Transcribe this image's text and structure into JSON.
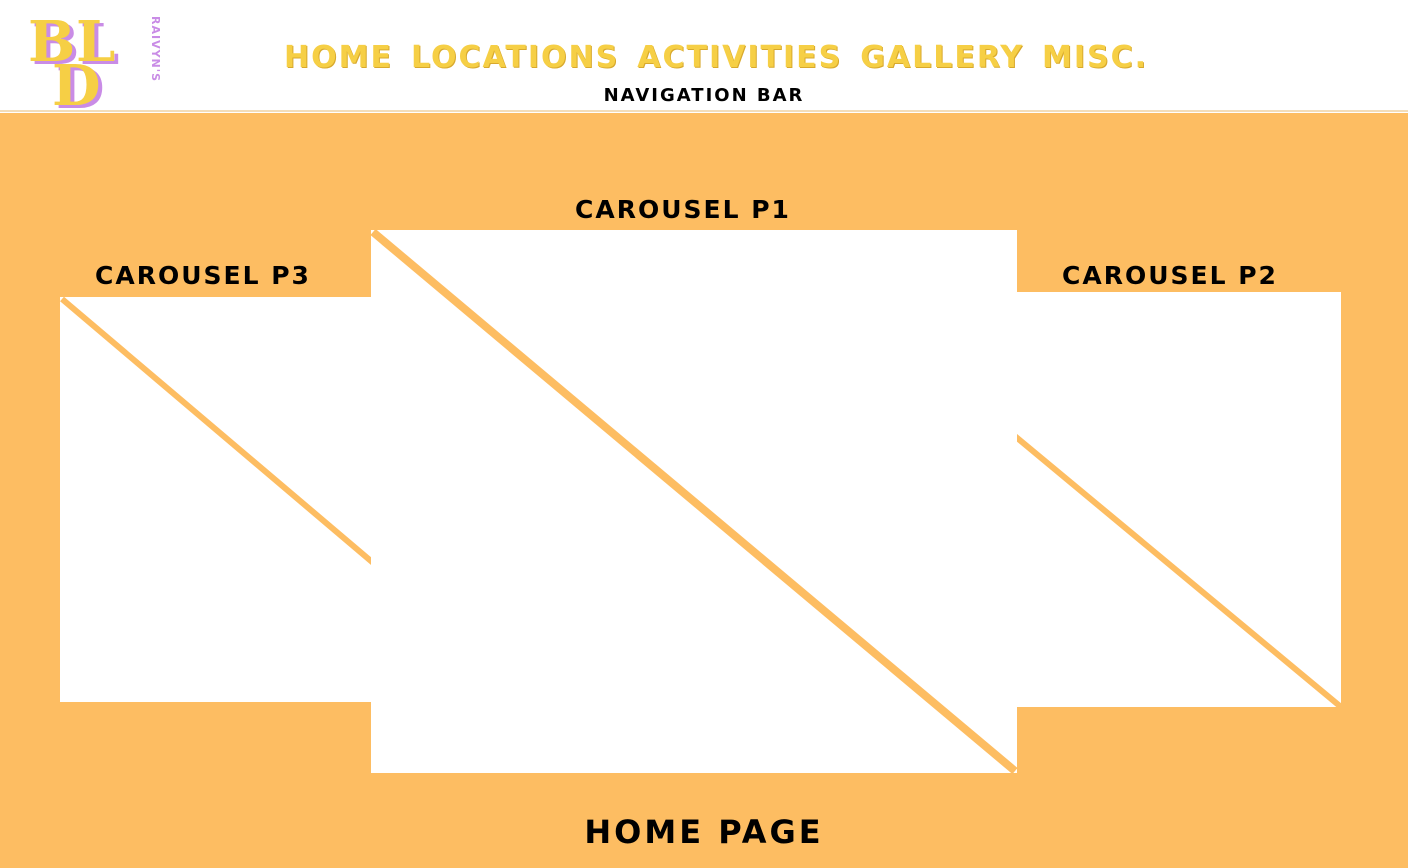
{
  "logo": {
    "letters": [
      "B",
      "L",
      "D"
    ],
    "script_text": "RAIVYN'S"
  },
  "nav": {
    "links": [
      "HOME",
      "LOCATIONS",
      "ACTIVITIES",
      "GALLERY",
      "MISC."
    ],
    "caption": "NAVIGATION BAR"
  },
  "carousel": {
    "p1_title": "CAROUSEL P1",
    "p2_title": "CAROUSEL P2",
    "p3_title": "CAROUSEL P3"
  },
  "footer": {
    "label": "HOME PAGE"
  },
  "colors": {
    "background": "#fdbd62",
    "logo_yellow": "#f6cf45",
    "logo_purple": "#c98ce6",
    "panel": "#ffffff",
    "text": "#000000"
  }
}
